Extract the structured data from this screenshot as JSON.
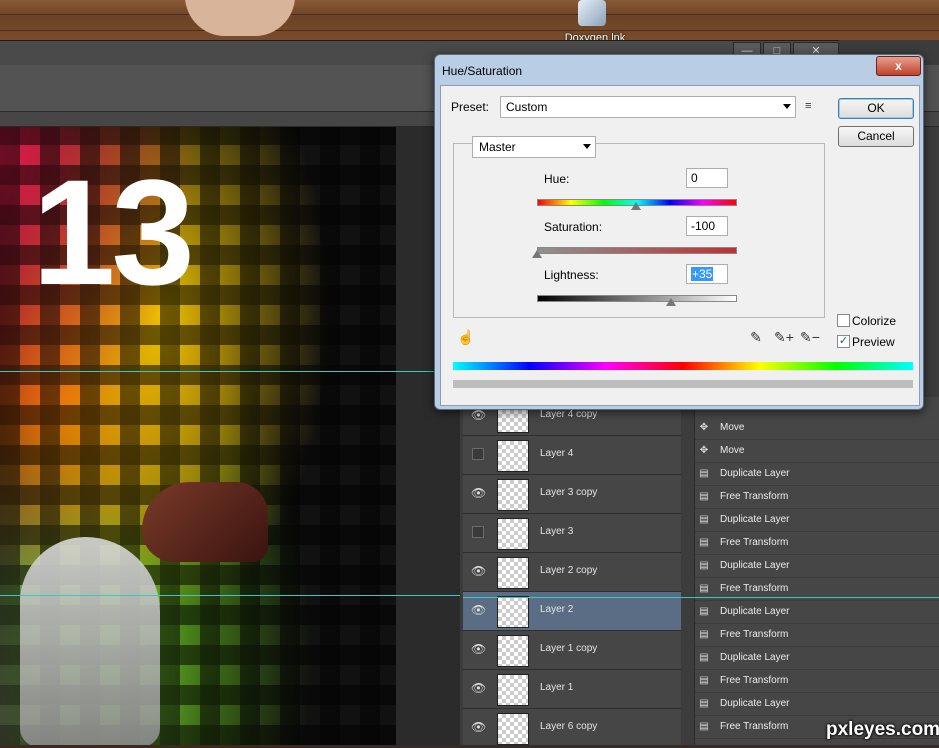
{
  "desktop": {
    "icon_label": "Doxygen.lnk",
    "icon_name": "shortcut-app-icon"
  },
  "window_controls": {
    "minimize": "—",
    "maximize": "□",
    "close": "✕"
  },
  "canvas": {
    "big_number": "13"
  },
  "layers_panel": {
    "rows": [
      {
        "name": "Layer 4 copy",
        "visible": true,
        "selected": false
      },
      {
        "name": "Layer 4",
        "visible": false,
        "selected": false
      },
      {
        "name": "Layer 3 copy",
        "visible": true,
        "selected": false
      },
      {
        "name": "Layer 3",
        "visible": false,
        "selected": false
      },
      {
        "name": "Layer 2 copy",
        "visible": true,
        "selected": false
      },
      {
        "name": "Layer 2",
        "visible": true,
        "selected": true
      },
      {
        "name": "Layer 1 copy",
        "visible": true,
        "selected": false
      },
      {
        "name": "Layer 1",
        "visible": true,
        "selected": false
      },
      {
        "name": "Layer 6 copy",
        "visible": true,
        "selected": false
      }
    ]
  },
  "history_panel": {
    "rows": [
      {
        "label": "Move",
        "icon": "move-icon"
      },
      {
        "label": "Move",
        "icon": "move-icon"
      },
      {
        "label": "Duplicate Layer",
        "icon": "document-icon"
      },
      {
        "label": "Free Transform",
        "icon": "document-icon"
      },
      {
        "label": "Duplicate Layer",
        "icon": "document-icon"
      },
      {
        "label": "Free Transform",
        "icon": "document-icon"
      },
      {
        "label": "Duplicate Layer",
        "icon": "document-icon"
      },
      {
        "label": "Free Transform",
        "icon": "document-icon"
      },
      {
        "label": "Duplicate Layer",
        "icon": "document-icon"
      },
      {
        "label": "Free Transform",
        "icon": "document-icon"
      },
      {
        "label": "Duplicate Layer",
        "icon": "document-icon"
      },
      {
        "label": "Free Transform",
        "icon": "document-icon"
      },
      {
        "label": "Duplicate Layer",
        "icon": "document-icon"
      },
      {
        "label": "Free Transform",
        "icon": "document-icon"
      }
    ]
  },
  "dialog": {
    "title": "Hue/Saturation",
    "close_glyph": "x",
    "preset_label": "Preset:",
    "preset_value": "Custom",
    "ok_label": "OK",
    "cancel_label": "Cancel",
    "channel_value": "Master",
    "hue_label": "Hue:",
    "hue_value": "0",
    "saturation_label": "Saturation:",
    "saturation_value": "-100",
    "lightness_label": "Lightness:",
    "lightness_value": "+35",
    "colorize_label": "Colorize",
    "colorize_checked": false,
    "preview_label": "Preview",
    "preview_checked": true,
    "check_glyph": "✓",
    "hand_glyph": "☝",
    "eyedropper_glyph": "✎",
    "eyedropper_plus_glyph": "✎+",
    "eyedropper_minus_glyph": "✎−",
    "menu_glyph": "≡",
    "eye_glyph": "👁",
    "move_glyph": "✥",
    "doc_glyph": "▤"
  },
  "colors": {
    "dialog_frame": "#b9cde4",
    "selection_blue": "#3399ff",
    "layer_selected": "#5a6d84",
    "guide_cyan": "#39c7c7"
  },
  "sliders": {
    "hue": 0,
    "saturation": -100,
    "lightness": 35
  },
  "watermark": "pxleyes.com"
}
